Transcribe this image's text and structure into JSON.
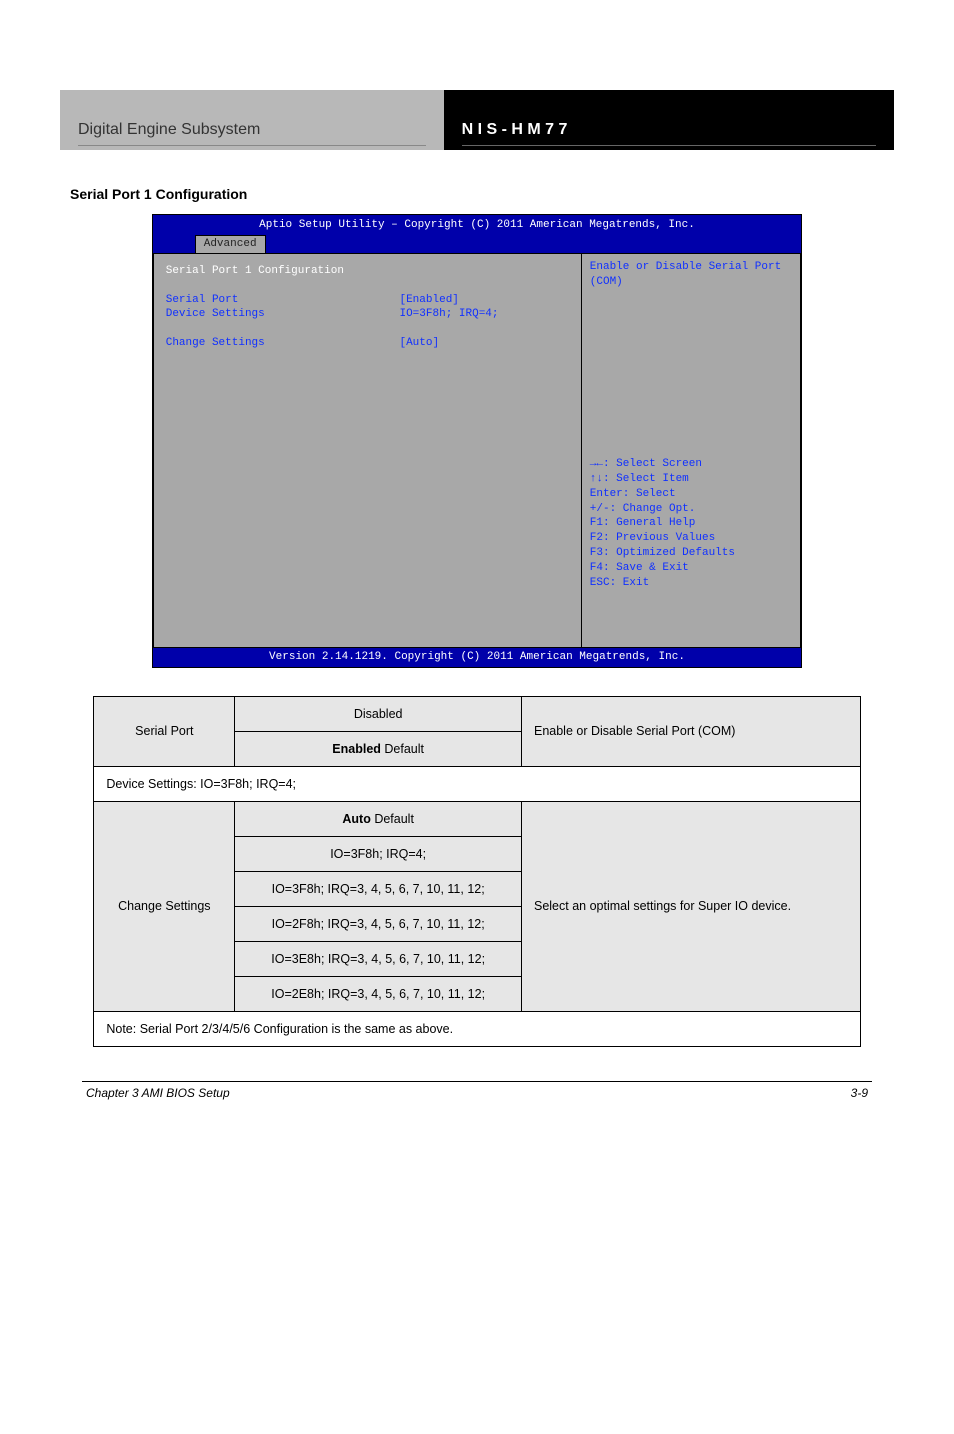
{
  "header": {
    "left": "Digital Engine Subsystem",
    "right": "N I S - H M 7 7"
  },
  "section_title": "Serial Port 1 Configuration",
  "bios": {
    "title": "Aptio Setup Utility – Copyright (C) 2011 American Megatrends, Inc.",
    "tab": "Advanced",
    "left": {
      "heading": "Serial Port 1 Configuration",
      "rows": [
        {
          "label": "Serial Port",
          "value": "[Enabled]"
        },
        {
          "label": "Device Settings",
          "value": "IO=3F8h; IRQ=4;"
        }
      ],
      "change_label": "Change Settings",
      "change_value": "[Auto]"
    },
    "right_top": "Enable or Disable Serial Port (COM)",
    "right_help": [
      "→←: Select Screen",
      "↑↓: Select Item",
      "Enter: Select",
      "+/-: Change Opt.",
      "F1: General Help",
      "F2: Previous Values",
      "F3: Optimized Defaults",
      "F4: Save & Exit",
      "ESC: Exit"
    ],
    "footer": "Version 2.14.1219. Copyright (C) 2011 American Megatrends, Inc."
  },
  "opts": {
    "r1_c1": "Serial Port",
    "r1_c2": "Disabled",
    "r1_c3": "Enable or Disable Serial Port (COM)",
    "r2_c2_default": "Enabled",
    "device_settings": "Device Settings: IO=3F8h; IRQ=4;",
    "cs_label": "Change Settings",
    "cs_opts": [
      "Auto",
      "IO=3F8h; IRQ=4;",
      "IO=3F8h; IRQ=3, 4, 5, 6, 7, 10, 11, 12;",
      "IO=2F8h; IRQ=3, 4, 5, 6, 7, 10, 11, 12;",
      "IO=3E8h; IRQ=3, 4, 5, 6, 7, 10, 11, 12;",
      "IO=2E8h; IRQ=3, 4, 5, 6, 7, 10, 11, 12;"
    ],
    "cs_desc": "Select an optimal settings for Super IO device.",
    "default_prefix": "Default",
    "note": "Note: Serial Port 2/3/4/5/6 Configuration is the same as above."
  },
  "footer": {
    "left": "Chapter 3 AMI BIOS Setup",
    "right": "3-9"
  }
}
